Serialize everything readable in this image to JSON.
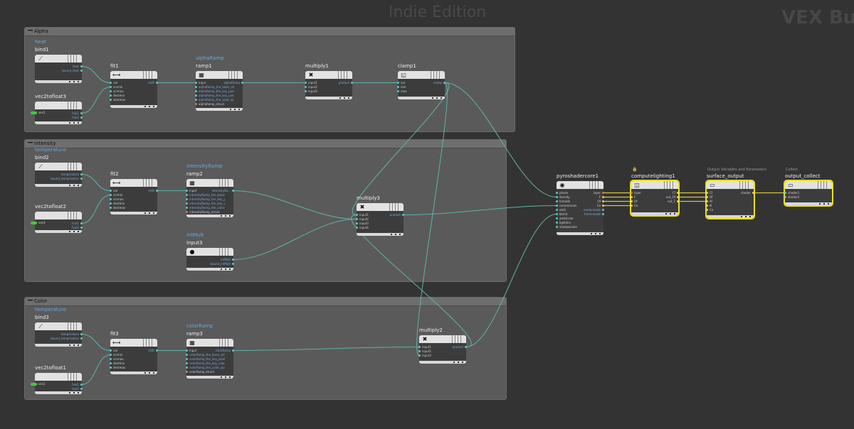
{
  "watermarks": {
    "edition": "Indie Edition",
    "context": "VEX Bui"
  },
  "boxes": {
    "alpha": "Alpha",
    "intensity": "Intensity",
    "color": "Color"
  },
  "nodes": {
    "bind1": {
      "parm": "heat",
      "name": "bind1",
      "outputs": [
        "heat",
        "bound_heat"
      ]
    },
    "vec2tofloat3": {
      "name": "vec2tofloat3",
      "inputs": [
        "vec2"
      ],
      "outputs": [
        "fval1",
        "fval2"
      ]
    },
    "fit1": {
      "name": "fit1",
      "inputs": [
        "val",
        "srcmin",
        "srcmax",
        "destmin",
        "destmax"
      ],
      "outputs": [
        "shift"
      ]
    },
    "ramp1": {
      "parm": "alphaRamp",
      "name": "ramp1",
      "inputs": [
        "input",
        "alphaRamp_the_basis_strin...",
        "alphaRamp_the_key_positi...",
        "alphaRamp_the_key_values",
        "alphaRamp_the_color_space",
        "alphaRamp_struct"
      ],
      "outputs": [
        "alphaRamp"
      ]
    },
    "multiply1": {
      "name": "multiply1",
      "inputs": [
        "input1",
        "input2",
        "input3"
      ],
      "outputs": [
        "product"
      ]
    },
    "clamp1": {
      "name": "clamp1",
      "inputs": [
        "val",
        "min",
        "max"
      ],
      "outputs": [
        "clamp"
      ]
    },
    "bind2": {
      "parm": "temperature",
      "name": "bind2",
      "outputs": [
        "temperature",
        "bound_temperature"
      ]
    },
    "vec2tofloat2": {
      "name": "vec2tofloat2",
      "inputs": [
        "vec2"
      ],
      "outputs": [
        "fval1",
        "fval2"
      ]
    },
    "fit2": {
      "name": "fit2",
      "inputs": [
        "val",
        "srcmin",
        "srcmax",
        "destmin",
        "destmax"
      ],
      "outputs": [
        "shift"
      ]
    },
    "ramp2": {
      "parm": "intensityRamp",
      "name": "ramp2",
      "inputs": [
        "input",
        "intensityRamp_the_basis_...",
        "intensityRamp_the_key_po...",
        "intensityRamp_the_key_v...",
        "intensityRamp_the_color_...",
        "intensityRamp_struct"
      ],
      "outputs": [
        "intensityRa..."
      ]
    },
    "input3": {
      "parm": "intMult",
      "name": "input3",
      "outputs": [
        "intMult",
        "bound_intMult"
      ]
    },
    "multiply3": {
      "name": "multiply3",
      "inputs": [
        "input1",
        "input2",
        "input3",
        "input4"
      ],
      "outputs": [
        "product"
      ]
    },
    "bind3": {
      "parm": "temperature",
      "name": "bind3",
      "outputs": [
        "temperature",
        "bound_temperature"
      ]
    },
    "vec2tofloat1": {
      "name": "vec2tofloat1",
      "inputs": [
        "vec2"
      ],
      "outputs": [
        "fval1",
        "fval2"
      ]
    },
    "fit3": {
      "name": "fit3",
      "inputs": [
        "val",
        "srcmin",
        "srcmax",
        "destmin",
        "destmax"
      ],
      "outputs": [
        "shift"
      ]
    },
    "ramp3": {
      "parm": "colorRamp",
      "name": "ramp3",
      "inputs": [
        "input",
        "colorRamp_the_basis_stri...",
        "colorRamp_the_key_positi...",
        "colorRamp_the_key_values",
        "colorRamp_the_color_space",
        "colorRamp_struct"
      ],
      "outputs": [
        "colorRamp"
      ]
    },
    "multiply2": {
      "name": "multiply2",
      "inputs": [
        "input1",
        "input2",
        "input3"
      ],
      "outputs": [
        "product"
      ]
    },
    "pyroshadercore1": {
      "name": "pyroshadercore1",
      "inputs": [
        "phase",
        "density",
        "tcmode",
        "cecemission",
        "emit",
        "Kemit",
        "amblcolor",
        "lightdirs",
        "shadowcolor"
      ],
      "outputs": [
        "layer",
        "F",
        "Of",
        "Ce",
        "rendermode",
        "framemode"
      ]
    },
    "computelighting1": {
      "name": "computelighting1",
      "inputs": [
        "layer",
        "F",
        "Of",
        "Ce"
      ],
      "outputs": [
        "Cf",
        "out_Of",
        "out_F"
      ]
    },
    "surface_output": {
      "caption": "Output Variables and Parameters",
      "name": "surface_output",
      "inputs": [
        "Cf",
        "Of",
        "Af",
        "N",
        "Ce"
      ],
      "outputs": [
        "shader"
      ]
    },
    "output_collect": {
      "caption": "Collect",
      "name": "output_collect",
      "inputs": [
        "shader1",
        "shader2"
      ]
    }
  },
  "colors": {
    "wire": "#5fb3a8",
    "wire_yellow": "#d9c440",
    "selection": "#e8e020",
    "param_label": "#6aa7dd",
    "port_float": "#5fc7c0",
    "port_green": "#3fcc3f"
  }
}
